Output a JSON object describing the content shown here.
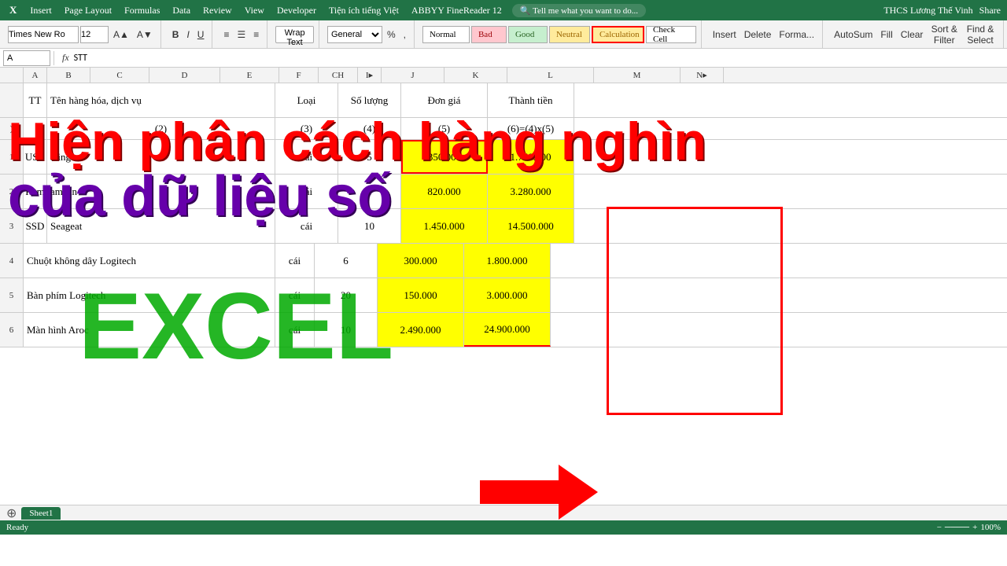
{
  "app": {
    "title": "THCS Lương Thế Vinh",
    "share_label": "Share"
  },
  "menu": {
    "items": [
      "Insert",
      "Page Layout",
      "Formulas",
      "Data",
      "Review",
      "View",
      "Developer",
      "Tiện ích tiếng Việt",
      "ABBYY FineReader 12",
      "Tell me what you want to do..."
    ]
  },
  "toolbar": {
    "font_name": "Times New Ro",
    "font_size": "12",
    "wrap_text": "Wrap Text",
    "number_format": "General",
    "normal_label": "Normal",
    "bad_label": "Bad",
    "good_label": "Good",
    "neutral_label": "Neutral",
    "calculation_label": "Calculation",
    "check_cell_label": "Check Cell",
    "autosum_label": "AutoSum",
    "fill_label": "Fill",
    "clear_label": "Clear",
    "sort_label": "Sort & Filter",
    "find_label": "Find & Select"
  },
  "formula_bar": {
    "name_box": "A",
    "formula": "STT"
  },
  "columns": {
    "headers": [
      "A",
      "B",
      "C",
      "D",
      "E",
      "F",
      "CH",
      "I",
      "J",
      "K",
      "L",
      "M",
      "N"
    ],
    "widths": [
      30,
      55,
      75,
      90,
      75,
      50,
      50,
      55,
      80,
      80,
      110,
      110,
      55
    ]
  },
  "rows": [
    {
      "num": "",
      "cells": [
        "TT",
        "Tên hàng hóa, dịch vụ",
        "",
        "",
        "",
        "",
        "Loại",
        "",
        "Số lượng",
        "",
        "Đơn giá",
        "Thành tiền",
        ""
      ]
    },
    {
      "num": ")",
      "cells": [
        "",
        "(2)",
        "",
        "",
        "",
        "",
        "(3)",
        "",
        "(4)",
        "",
        "(5)",
        "(6)=(4)x(5)",
        ""
      ]
    },
    {
      "num": "1",
      "cells": [
        "USB",
        "Kingto",
        "",
        "",
        "",
        "",
        "cái",
        "",
        "5",
        "",
        "350.000",
        "1.750.000",
        ""
      ]
    },
    {
      "num": "2",
      "cells": [
        "Ram",
        "amsun",
        "",
        "",
        "",
        "",
        "cái",
        "",
        "4",
        "",
        "820.000",
        "3.280.000",
        ""
      ]
    },
    {
      "num": "3",
      "cells": [
        "SSD Seageat",
        "",
        "",
        "",
        "",
        "",
        "cái",
        "",
        "10",
        "",
        "1.450.000",
        "14.500.000",
        ""
      ]
    },
    {
      "num": "4",
      "cells": [
        "Chuột không dây Logitech",
        "",
        "",
        "",
        "",
        "",
        "cái",
        "",
        "6",
        "",
        "300.000",
        "1.800.000",
        ""
      ]
    },
    {
      "num": "5",
      "cells": [
        "Bàn phím Logitech",
        "",
        "",
        "",
        "",
        "",
        "cái",
        "",
        "20",
        "",
        "150.000",
        "3.000.000",
        ""
      ]
    },
    {
      "num": "6",
      "cells": [
        "Màn hình Aroc",
        "",
        "",
        "",
        "",
        "",
        "cái",
        "",
        "10",
        "",
        "2.490.000",
        "24.900.000",
        ""
      ]
    }
  ],
  "overlay": {
    "line1": "Hiện phân cách hàng nghìn",
    "line2": "của dữ liệu số",
    "excel_text": "EXCEL"
  },
  "status_bar": {
    "sheet1": "Sheet1",
    "zoom": "100%"
  }
}
